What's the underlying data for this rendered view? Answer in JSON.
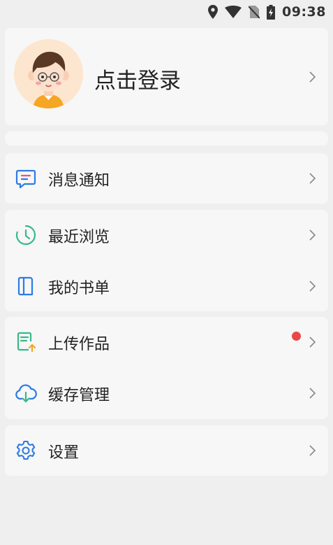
{
  "status_bar": {
    "time": "09:38",
    "icons": [
      "location-icon",
      "wifi-icon",
      "no-sim-icon",
      "battery-charging-icon"
    ]
  },
  "profile": {
    "login_label": "点击登录"
  },
  "menu": {
    "notifications": {
      "label": "消息通知",
      "icon": "message-icon"
    },
    "recent": {
      "label": "最近浏览",
      "icon": "clock-icon"
    },
    "booklist": {
      "label": "我的书单",
      "icon": "book-icon"
    },
    "upload": {
      "label": "上传作品",
      "icon": "upload-doc-icon",
      "has_badge": true
    },
    "cache": {
      "label": "缓存管理",
      "icon": "cloud-download-icon"
    },
    "settings": {
      "label": "设置",
      "icon": "gear-icon"
    }
  },
  "colors": {
    "accent_blue": "#2d7be5",
    "accent_green": "#39b889",
    "badge_red": "#e84848",
    "avatar_bg": "#fde6cf"
  }
}
